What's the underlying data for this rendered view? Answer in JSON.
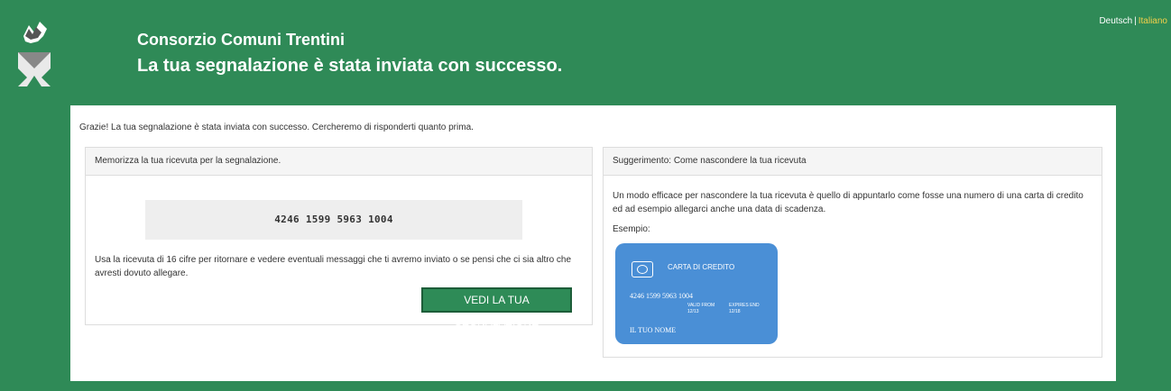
{
  "header": {
    "org_name": "Consorzio Comuni Trentini",
    "headline": "La tua segnalazione è stata inviata con successo."
  },
  "language": {
    "items": [
      {
        "label": "Deutsch",
        "active": false
      },
      {
        "label": "Italiano",
        "active": true
      }
    ],
    "separator": "|"
  },
  "intro": "Grazie! La tua segnalazione è stata inviata con successo. Cercheremo di risponderti quanto prima.",
  "receipt_panel": {
    "title": "Memorizza la tua ricevuta per la segnalazione.",
    "receipt": "4246 1599 5963 1004",
    "instructions": "Usa la ricevuta di 16 cifre per ritornare e vedere eventuali messaggi che ti avremo inviato o se pensi che ci sia altro che avresti dovuto allegare.",
    "button": "VEDI LA TUA SEGNALAZIONE"
  },
  "tip_panel": {
    "title": "Suggerimento: Come nascondere la tua ricevuta",
    "text": "Un modo efficace per nascondere la tua ricevuta è quello di appuntarlo come fosse una numero di una carta di credito ed ad esempio allegarci anche una data di scadenza.",
    "example_label": "Esempio:",
    "card": {
      "title": "CARTA DI CREDITO",
      "number": "4246 1599 5963 1004",
      "valid_from_label": "VALID FROM",
      "valid_from": "12/13",
      "expires_label": "EXPIRES END",
      "expires": "12/18",
      "name": "IL TUO NOME"
    }
  },
  "colors": {
    "background": "#2f8a57",
    "button": "#2e8b57",
    "card": "#4a8fd6"
  }
}
